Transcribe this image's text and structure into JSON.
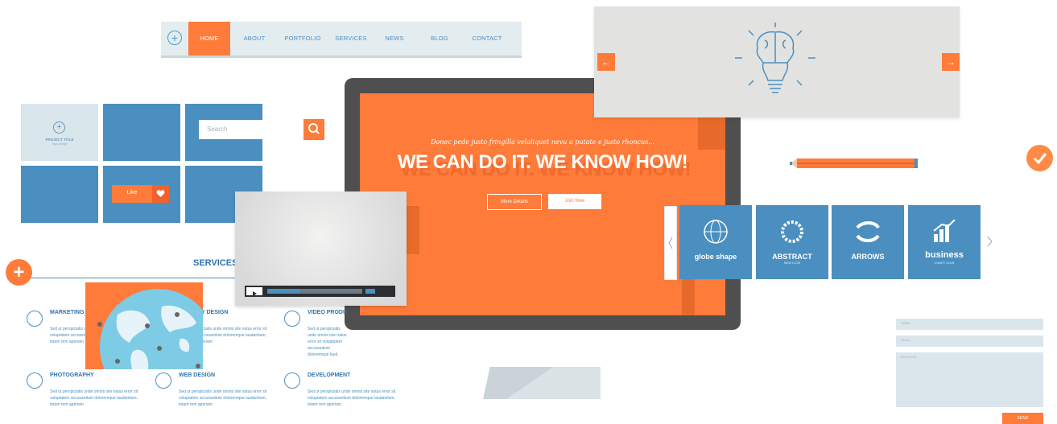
{
  "nav": {
    "items": [
      "HOME",
      "ABOUT",
      "PORTFOLIO",
      "SERVICES",
      "NEWS",
      "BLOG",
      "CONTACT"
    ],
    "active": "HOME"
  },
  "grid": {
    "project_title": "PROJECT TITLE",
    "project_subtitle": "Tags Design",
    "search_placeholder": "Search",
    "like_label": "Like"
  },
  "hero": {
    "subtitle": "Donec pede justo fringilla velaliquet nevu a putate e justo rhoncus...",
    "title": "WE CAN DO IT. WE KNOW HOW!",
    "btn_more": "More Details",
    "btn_join": "Join Now"
  },
  "logos": [
    {
      "name": "globe shape",
      "sub": ""
    },
    {
      "name": "ABSTRACT",
      "sub": "NEW ICON"
    },
    {
      "name": "ARROWS",
      "sub": ""
    },
    {
      "name": "business",
      "sub": "CHART ICON"
    }
  ],
  "services": {
    "title": "SERVICES",
    "items": [
      {
        "title": "MARKETING",
        "text": "Sed ut perspiciatis unde omnis iste natus error sit voluptatem accusantium doloremque laudantium, totam rem aperiam"
      },
      {
        "title": "Y DESIGN",
        "text": "Sed ut perspiciatis unde omnis iste natus error sit voluptatem accusantium doloremque laudantium, totam rem aperiam"
      },
      {
        "title": "VIDEO PRODU",
        "text": "Sed ut perspiciatis unde omnis iste natus error sit voluptatem accusantium doloremque laud."
      },
      {
        "title": "PHOTOGRAPHY",
        "text": "Sed ut perspiciatis unde omnis iste natus error sit voluptatem accusantium doloremque laudantium, totam rem aperiam"
      },
      {
        "title": "WEB DESIGN",
        "text": "Sed ut perspiciatis unde omnis iste natus error sit voluptatem accusantium doloremque laudantium, totam rem aperiam"
      },
      {
        "title": "DEVELOPMENT",
        "text": "Sed ut perspiciatis unde omnis iste natus error sit voluptatem accusantium doloremque laudantium, totam rem aperiam"
      }
    ]
  },
  "video": {
    "progress": 0.35
  },
  "contact": {
    "name_placeholder": "NAME",
    "email_placeholder": "EMAIL",
    "message_placeholder": "MESSAGE",
    "send_label": "SEND"
  },
  "colors": {
    "accent": "#ff7b3a",
    "blue": "#4a8fc0",
    "dark": "#4f4f4f"
  },
  "icons": [
    "plus-icon",
    "search-icon",
    "heart-icon",
    "arrow-left-icon",
    "arrow-right-icon",
    "lightbulb-brain-icon",
    "play-icon",
    "check-icon",
    "chevron-left-icon",
    "chevron-right-icon"
  ]
}
